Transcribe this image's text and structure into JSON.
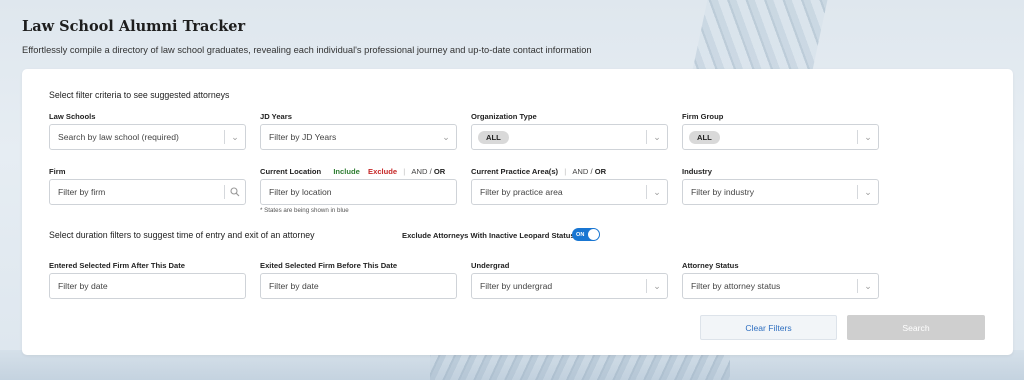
{
  "header": {
    "title": "Law School Alumni Tracker",
    "subtitle": "Effortlessly compile a directory of law school graduates, revealing each individual's professional journey and up-to-date contact information"
  },
  "sections": {
    "filter_prompt": "Select filter criteria to see suggested attorneys",
    "duration_prompt": "Select duration filters to suggest time of entry and exit of an attorney"
  },
  "filters": {
    "law_schools": {
      "label": "Law Schools",
      "placeholder": "Search by law school (required)"
    },
    "jd_years": {
      "label": "JD Years",
      "placeholder": "Filter by JD Years"
    },
    "organization_type": {
      "label": "Organization Type",
      "chip": "ALL"
    },
    "firm_group": {
      "label": "Firm Group",
      "chip": "ALL"
    },
    "firm": {
      "label": "Firm",
      "placeholder": "Filter by firm"
    },
    "current_location": {
      "label": "Current Location",
      "include": "Include",
      "exclude": "Exclude",
      "and": "AND",
      "slash": "/",
      "or": "OR",
      "placeholder": "Filter by location",
      "hint": "* States are being shown in blue"
    },
    "practice_area": {
      "label": "Current Practice Area(s)",
      "and": "AND",
      "slash": "/",
      "or": "OR",
      "placeholder": "Filter by practice area"
    },
    "industry": {
      "label": "Industry",
      "placeholder": "Filter by industry"
    },
    "entered_after": {
      "label": "Entered Selected Firm After This Date",
      "placeholder": "Filter by date"
    },
    "exited_before": {
      "label": "Exited Selected Firm Before This Date",
      "placeholder": "Filter by date"
    },
    "undergrad": {
      "label": "Undergrad",
      "placeholder": "Filter by undergrad"
    },
    "attorney_status": {
      "label": "Attorney Status",
      "placeholder": "Filter by attorney status"
    }
  },
  "toggle": {
    "label": "Exclude Attorneys With Inactive Leopard Status",
    "state": "ON"
  },
  "actions": {
    "clear": "Clear Filters",
    "search": "Search"
  },
  "icons": {
    "chevron": "chevron-down-icon",
    "search": "search-icon"
  },
  "colors": {
    "include": "#2e7d32",
    "exclude": "#c62828",
    "toggle_on": "#1976d2",
    "clear_text": "#2f6fc0",
    "search_disabled": "#cfcfcf"
  }
}
